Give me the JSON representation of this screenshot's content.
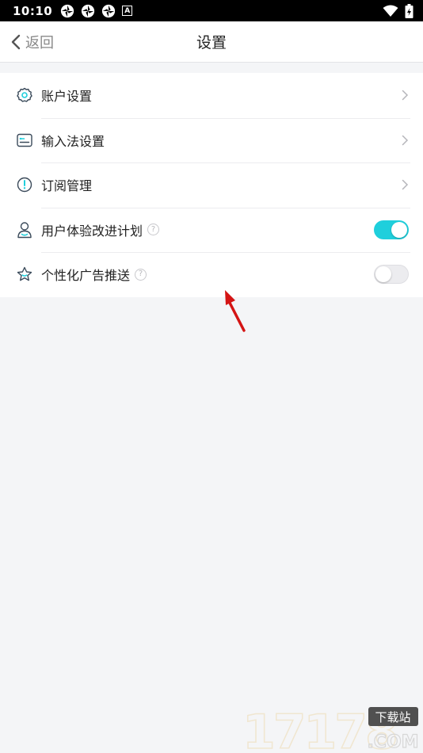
{
  "status_bar": {
    "time": "10:10",
    "notification_icons": [
      "pinwheel-icon",
      "pinwheel-icon",
      "pinwheel-icon",
      "a-badge-icon"
    ],
    "right_icons": [
      "wifi-icon",
      "battery-icon"
    ],
    "a_badge": "A"
  },
  "nav": {
    "back_label": "返回",
    "title": "设置"
  },
  "settings": [
    {
      "icon": "gear-icon",
      "label": "账户设置",
      "control": "chevron"
    },
    {
      "icon": "keyboard-icon",
      "label": "输入法设置",
      "control": "chevron"
    },
    {
      "icon": "exclamation-circle-icon",
      "label": "订阅管理",
      "control": "chevron"
    },
    {
      "icon": "user-icon",
      "label": "用户体验改进计划",
      "control": "toggle",
      "help": "?",
      "enabled": true
    },
    {
      "icon": "star-icon",
      "label": "个性化广告推送",
      "control": "toggle",
      "help": "?",
      "enabled": false
    }
  ],
  "colors": {
    "accent": "#1fcfdc",
    "background": "#f4f5f7",
    "annotation_arrow": "#d41414"
  },
  "watermark": {
    "number": "17178",
    "badge": "下载站",
    "domain": ".COM"
  }
}
